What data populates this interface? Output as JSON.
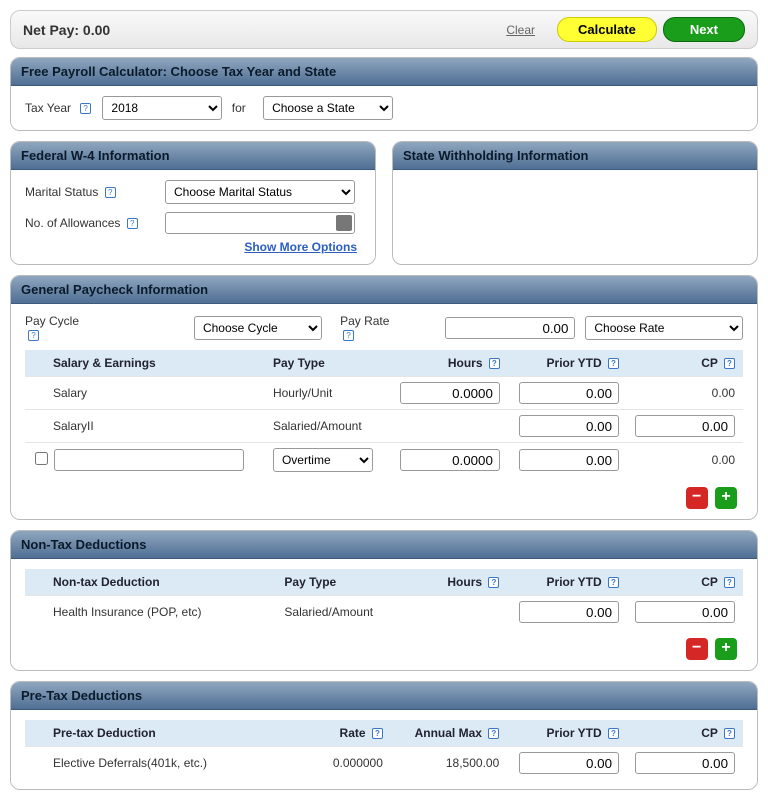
{
  "top": {
    "netpay_label": "Net Pay: 0.00",
    "clear": "Clear",
    "calculate": "Calculate",
    "next": "Next"
  },
  "taxyear": {
    "title": "Free Payroll Calculator: Choose Tax Year and State",
    "tax_year_label": "Tax Year",
    "tax_year_value": "2018",
    "for_label": "for",
    "state_value": "Choose a State"
  },
  "w4": {
    "title": "Federal W-4 Information",
    "marital_label": "Marital Status",
    "marital_value": "Choose Marital Status",
    "allow_label": "No. of Allowances",
    "more": "Show More Options"
  },
  "stateinfo": {
    "title": "State Withholding Information"
  },
  "paycheck": {
    "title": "General Paycheck Information",
    "paycycle_label": "Pay Cycle",
    "paycycle_value": "Choose Cycle",
    "payrate_label": "Pay Rate",
    "payrate_value": "0.00",
    "payrate_unit": "Choose Rate",
    "cols": {
      "c1": "Salary & Earnings",
      "c2": "Pay Type",
      "c3": "Hours",
      "c4": "Prior YTD",
      "c5": "CP"
    },
    "rows": [
      {
        "name": "Salary",
        "paytype": "Hourly/Unit",
        "hours": "0.0000",
        "ytd": "0.00",
        "cp": "0.00",
        "hours_input": true,
        "ytd_input": true,
        "cp_input": false
      },
      {
        "name": "SalaryII",
        "paytype": "Salaried/Amount",
        "hours": "",
        "ytd": "0.00",
        "cp": "0.00",
        "hours_input": false,
        "ytd_input": true,
        "cp_input": true
      }
    ],
    "custom": {
      "paytype_value": "Overtime",
      "hours": "0.0000",
      "ytd": "0.00",
      "cp": "0.00"
    }
  },
  "nontax": {
    "title": "Non-Tax Deductions",
    "cols": {
      "c1": "Non-tax Deduction",
      "c2": "Pay Type",
      "c3": "Hours",
      "c4": "Prior YTD",
      "c5": "CP"
    },
    "row": {
      "name": "Health Insurance (POP, etc)",
      "paytype": "Salaried/Amount",
      "ytd": "0.00",
      "cp": "0.00"
    }
  },
  "pretax": {
    "title": "Pre-Tax Deductions",
    "cols": {
      "c1": "Pre-tax Deduction",
      "c2": "Rate",
      "c3": "Annual Max",
      "c4": "Prior YTD",
      "c5": "CP"
    },
    "row": {
      "name": "Elective Deferrals(401k, etc.)",
      "rate": "0.000000",
      "max": "18,500.00",
      "ytd": "0.00",
      "cp": "0.00"
    }
  }
}
